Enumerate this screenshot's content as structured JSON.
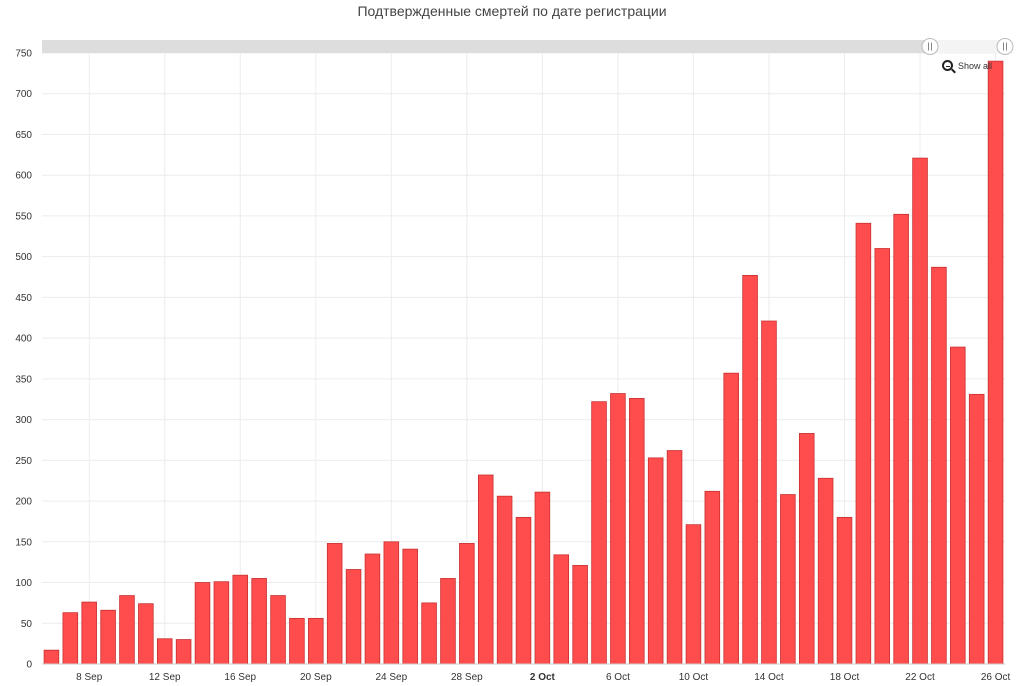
{
  "chart_data": {
    "type": "bar",
    "title": "Подтвержденные смертей по дате регистрации",
    "xlabel": "",
    "ylabel": "",
    "ylim": [
      0,
      750
    ],
    "yticks": [
      0,
      50,
      100,
      150,
      200,
      250,
      300,
      350,
      400,
      450,
      500,
      550,
      600,
      650,
      700,
      750
    ],
    "grid": true,
    "color": "#ff4d4d",
    "categories": [
      "6 Sep",
      "7 Sep",
      "8 Sep",
      "9 Sep",
      "10 Sep",
      "11 Sep",
      "12 Sep",
      "13 Sep",
      "14 Sep",
      "15 Sep",
      "16 Sep",
      "17 Sep",
      "18 Sep",
      "19 Sep",
      "20 Sep",
      "21 Sep",
      "22 Sep",
      "23 Sep",
      "24 Sep",
      "25 Sep",
      "26 Sep",
      "27 Sep",
      "28 Sep",
      "29 Sep",
      "30 Sep",
      "1 Oct",
      "2 Oct",
      "3 Oct",
      "4 Oct",
      "5 Oct",
      "6 Oct",
      "7 Oct",
      "8 Oct",
      "9 Oct",
      "10 Oct",
      "11 Oct",
      "12 Oct",
      "13 Oct",
      "14 Oct",
      "15 Oct",
      "16 Oct",
      "17 Oct",
      "18 Oct",
      "19 Oct",
      "20 Oct",
      "21 Oct",
      "22 Oct",
      "23 Oct",
      "24 Oct",
      "25 Oct",
      "26 Oct"
    ],
    "values": [
      17,
      63,
      76,
      66,
      84,
      74,
      31,
      30,
      100,
      101,
      109,
      105,
      84,
      56,
      56,
      148,
      116,
      135,
      150,
      141,
      75,
      105,
      148,
      232,
      206,
      180,
      211,
      134,
      121,
      322,
      332,
      326,
      253,
      262,
      171,
      212,
      357,
      477,
      421,
      208,
      283,
      228,
      180,
      541,
      510,
      552,
      621,
      487,
      389,
      331,
      740
    ],
    "x_tick_labels": [
      {
        "index": 2,
        "label": "8 Sep",
        "bold": false
      },
      {
        "index": 6,
        "label": "12 Sep",
        "bold": false
      },
      {
        "index": 10,
        "label": "16 Sep",
        "bold": false
      },
      {
        "index": 14,
        "label": "20 Sep",
        "bold": false
      },
      {
        "index": 18,
        "label": "24 Sep",
        "bold": false
      },
      {
        "index": 22,
        "label": "28 Sep",
        "bold": false
      },
      {
        "index": 26,
        "label": "2 Oct",
        "bold": true
      },
      {
        "index": 30,
        "label": "6 Oct",
        "bold": false
      },
      {
        "index": 34,
        "label": "10 Oct",
        "bold": false
      },
      {
        "index": 38,
        "label": "14 Oct",
        "bold": false
      },
      {
        "index": 42,
        "label": "18 Oct",
        "bold": false
      },
      {
        "index": 46,
        "label": "22 Oct",
        "bold": false
      },
      {
        "index": 50,
        "label": "26 Oct",
        "bold": false
      }
    ]
  },
  "controls": {
    "show_all_label": "Show all"
  },
  "colors": {
    "scrollbar_track": "#dddddd",
    "grid": "#ececec"
  }
}
